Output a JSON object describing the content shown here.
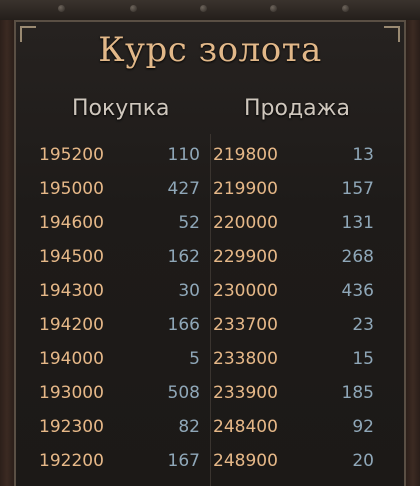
{
  "title": "Курс золота",
  "headers": {
    "buy": "Покупка",
    "sell": "Продажа"
  },
  "colors": {
    "price": "#e6b888",
    "quantity": "#8fa7b8",
    "title": "#e2b889",
    "header": "#cfc7bd"
  },
  "rows": [
    {
      "buy_price": "195200",
      "buy_qty": "110",
      "sell_price": "219800",
      "sell_qty": "13"
    },
    {
      "buy_price": "195000",
      "buy_qty": "427",
      "sell_price": "219900",
      "sell_qty": "157"
    },
    {
      "buy_price": "194600",
      "buy_qty": "52",
      "sell_price": "220000",
      "sell_qty": "131"
    },
    {
      "buy_price": "194500",
      "buy_qty": "162",
      "sell_price": "229900",
      "sell_qty": "268"
    },
    {
      "buy_price": "194300",
      "buy_qty": "30",
      "sell_price": "230000",
      "sell_qty": "436"
    },
    {
      "buy_price": "194200",
      "buy_qty": "166",
      "sell_price": "233700",
      "sell_qty": "23"
    },
    {
      "buy_price": "194000",
      "buy_qty": "5",
      "sell_price": "233800",
      "sell_qty": "15"
    },
    {
      "buy_price": "193000",
      "buy_qty": "508",
      "sell_price": "233900",
      "sell_qty": "185"
    },
    {
      "buy_price": "192300",
      "buy_qty": "82",
      "sell_price": "248400",
      "sell_qty": "92"
    },
    {
      "buy_price": "192200",
      "buy_qty": "167",
      "sell_price": "248900",
      "sell_qty": "20"
    }
  ]
}
